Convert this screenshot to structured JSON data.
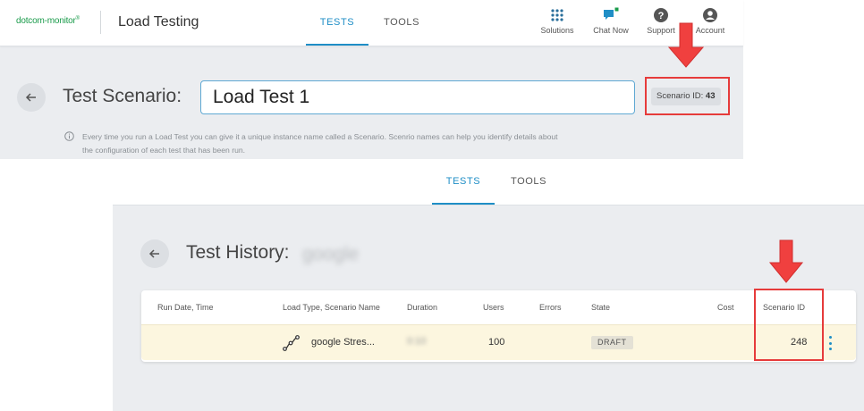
{
  "panel1": {
    "logo": {
      "text": "dotcom-monitor",
      "tm": "®"
    },
    "app_title": "Load Testing",
    "tabs": [
      {
        "label": "TESTS",
        "active": true
      },
      {
        "label": "TOOLS",
        "active": false
      }
    ],
    "nav": [
      {
        "label": "Solutions",
        "icon": "grid-icon"
      },
      {
        "label": "Chat Now",
        "icon": "chat-icon"
      },
      {
        "label": "Support",
        "icon": "help-icon"
      },
      {
        "label": "Account",
        "icon": "account-icon"
      }
    ],
    "scenario_label": "Test Scenario:",
    "scenario_name": "Load Test 1",
    "scenario_id_label": "Scenario ID:",
    "scenario_id_value": "43",
    "info_text": "Every time you run a Load Test you can give it a unique instance name called a Scenario. Scenrio names can help you identify details about the configuration of each test that has been run."
  },
  "panel2": {
    "tabs": [
      {
        "label": "TESTS",
        "active": true
      },
      {
        "label": "TOOLS",
        "active": false
      }
    ],
    "history_label": "Test History:",
    "history_name_redacted": "google",
    "columns": [
      "Run Date, Time",
      "Load Type, Scenario Name",
      "Duration",
      "Users",
      "Errors",
      "State",
      "Cost",
      "Scenario ID"
    ],
    "row": {
      "run_date": "",
      "scenario_name": "google Stres...",
      "duration_redacted": "0:10",
      "users": "100",
      "errors": "",
      "state": "DRAFT",
      "cost": "",
      "scenario_id": "248",
      "load_type_icon": "stress-curve-icon"
    }
  },
  "colors": {
    "accent": "#1f8ec6",
    "brand_green": "#1a9b4b",
    "highlight_red": "#e63b3b",
    "row_highlight": "#fcf6df"
  }
}
